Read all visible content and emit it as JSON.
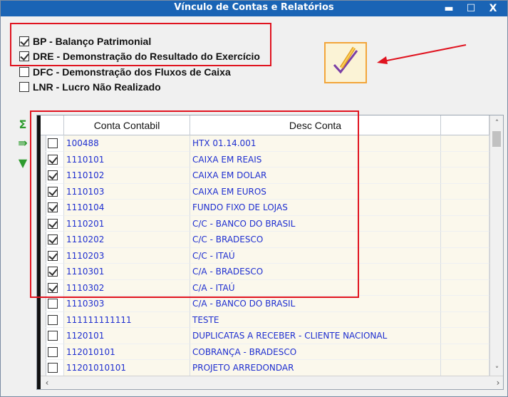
{
  "window": {
    "title": "Vínculo de Contas e Relatórios",
    "min_label": "▬",
    "max_label": "☐",
    "close_label": "X"
  },
  "options": [
    {
      "label": "BP - Balanço Patrimonial",
      "checked": true
    },
    {
      "label": "DRE - Demonstração do Resultado do Exercício",
      "checked": true
    },
    {
      "label": "DFC - Demonstração dos Fluxos de Caixa",
      "checked": false
    },
    {
      "label": "LNR - Lucro Não Realizado",
      "checked": false
    }
  ],
  "confirm_icon": "checkmark-icon",
  "side_icons": [
    "sigma-icon",
    "export-icon",
    "filter-icon"
  ],
  "grid": {
    "headers": [
      "Conta Contabil",
      "Desc Conta"
    ],
    "rows": [
      {
        "conta": "100488",
        "desc": "HTX 01.14.001",
        "checked": false
      },
      {
        "conta": "1110101",
        "desc": "CAIXA EM REAIS",
        "checked": true
      },
      {
        "conta": "1110102",
        "desc": "CAIXA EM DOLAR",
        "checked": true
      },
      {
        "conta": "1110103",
        "desc": "CAIXA EM EUROS",
        "checked": true
      },
      {
        "conta": "1110104",
        "desc": "FUNDO FIXO DE LOJAS",
        "checked": true
      },
      {
        "conta": "1110201",
        "desc": "C/C - BANCO DO BRASIL",
        "checked": true
      },
      {
        "conta": "1110202",
        "desc": "C/C - BRADESCO",
        "checked": true
      },
      {
        "conta": "1110203",
        "desc": "C/C - ITAÚ",
        "checked": true
      },
      {
        "conta": "1110301",
        "desc": "C/A - BRADESCO",
        "checked": true
      },
      {
        "conta": "1110302",
        "desc": "C/A - ITAÚ",
        "checked": true
      },
      {
        "conta": "1110303",
        "desc": "C/A - BANCO DO BRASIL",
        "checked": false
      },
      {
        "conta": "111111111111",
        "desc": "TESTE",
        "checked": false
      },
      {
        "conta": "1120101",
        "desc": "DUPLICATAS A RECEBER - CLIENTE NACIONAL",
        "checked": false
      },
      {
        "conta": "112010101",
        "desc": "COBRANÇA - BRADESCO",
        "checked": false
      },
      {
        "conta": "11201010101",
        "desc": "PROJETO ARREDONDAR",
        "checked": false
      }
    ]
  },
  "colors": {
    "titlebar": "#1a64b5",
    "highlight": "#e0131f",
    "row_text": "#1f2fd0",
    "row_bg": "#fbf8ec"
  }
}
